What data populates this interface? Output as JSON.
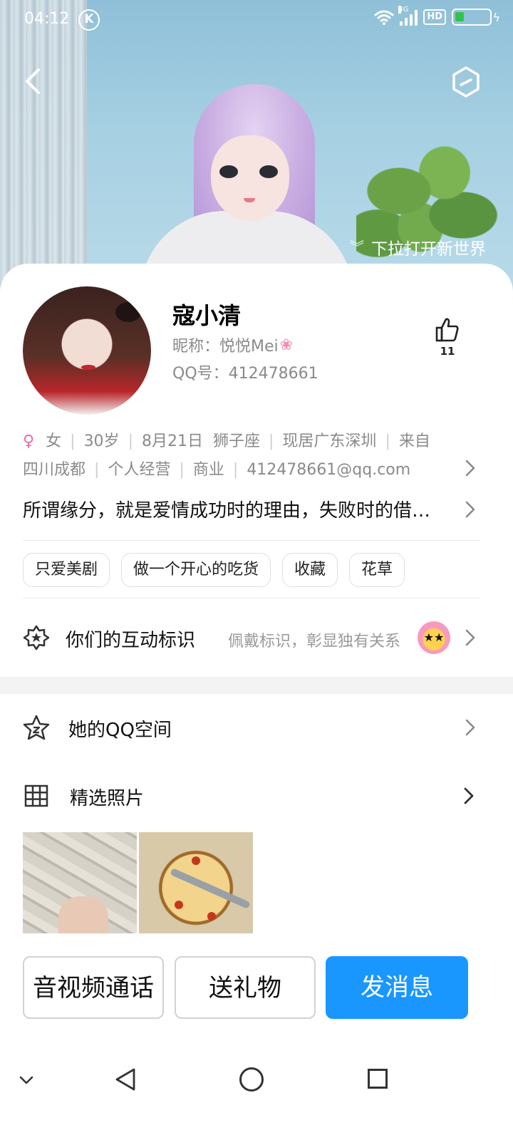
{
  "status_bar": {
    "time": "04:12",
    "k_badge": "K",
    "network": "4G",
    "hd": "HD"
  },
  "header": {
    "pull_hint": "下拉打开新世界"
  },
  "profile": {
    "name": "寇小清",
    "nickname": "昵称：悦悦Mei",
    "qq_number": "QQ号：412478661",
    "like_count": "11"
  },
  "info": {
    "gender": "女",
    "age": "30岁",
    "birthday": "8月21日",
    "zodiac": "狮子座",
    "location": "现居广东深圳",
    "hometown_prefix": "来自",
    "hometown": "四川成都",
    "occupation": "个人经营",
    "industry": "商业",
    "email": "412478661@qq.com"
  },
  "signature": "所谓缘分，就是爱情成功时的理由，失败时的借…",
  "tags": [
    "只爱美剧",
    "做一个开心的吃货",
    "收藏",
    "花草"
  ],
  "interaction": {
    "label": "你们的互动标识",
    "hint": "佩戴标识，彰显独有关系"
  },
  "qzone": {
    "label": "她的QQ空间"
  },
  "photos": {
    "label": "精选照片"
  },
  "actions": {
    "call": "音视频通话",
    "gift": "送礼物",
    "message": "发消息"
  },
  "colors": {
    "primary": "#1a97ff",
    "female": "#e86aa8",
    "secondary_text": "#8a8a8a"
  }
}
